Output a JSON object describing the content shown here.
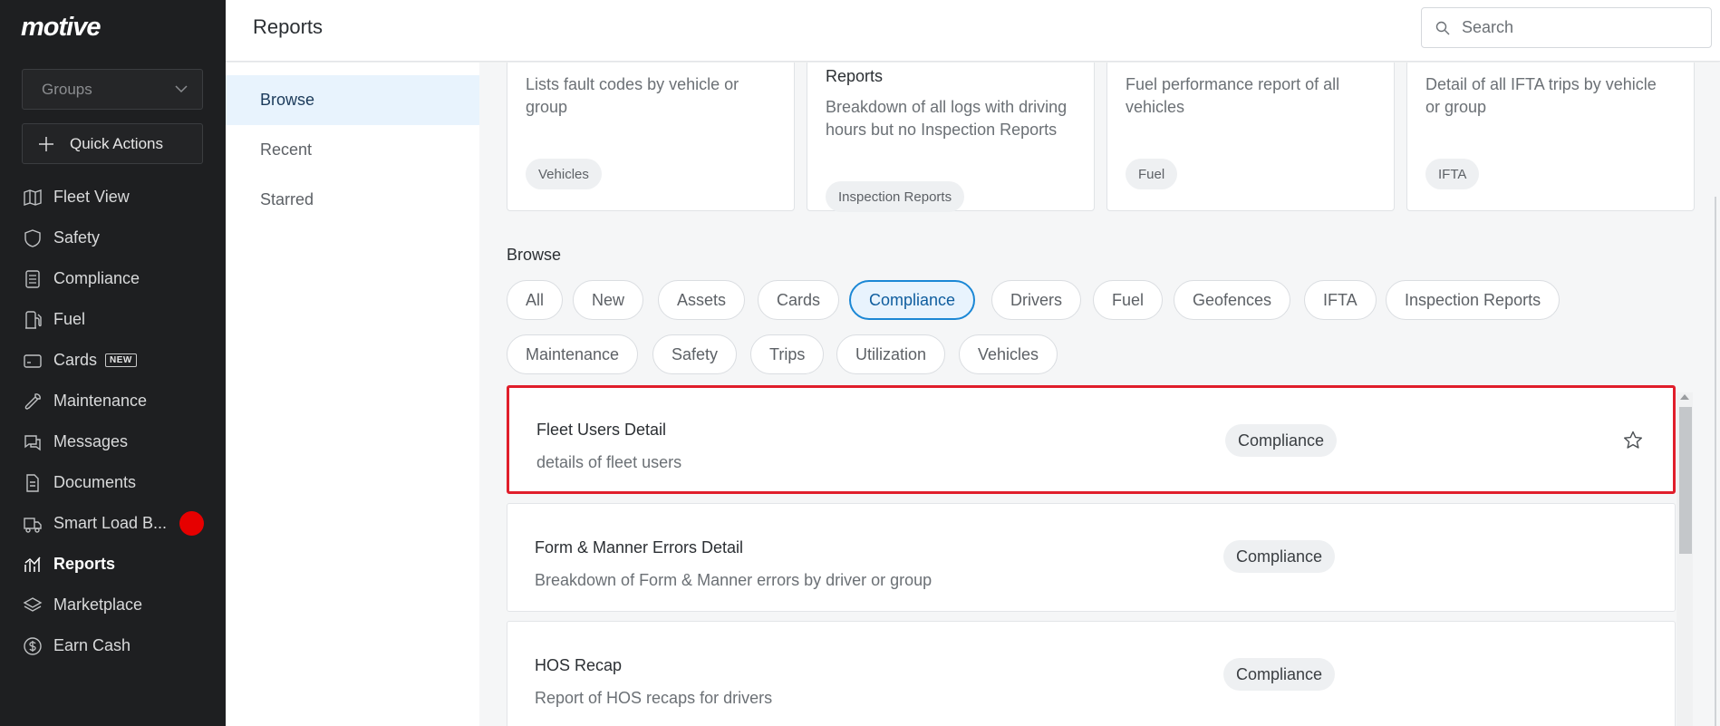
{
  "sidebar": {
    "logo": "motive",
    "groups_placeholder": "Groups",
    "quick_actions": "Quick Actions",
    "items": [
      {
        "label": "Fleet View",
        "icon": "map-icon"
      },
      {
        "label": "Safety",
        "icon": "shield-icon"
      },
      {
        "label": "Compliance",
        "icon": "document-list-icon"
      },
      {
        "label": "Fuel",
        "icon": "fuel-pump-icon"
      },
      {
        "label": "Cards",
        "icon": "card-icon",
        "badge": "NEW"
      },
      {
        "label": "Maintenance",
        "icon": "wrench-icon"
      },
      {
        "label": "Messages",
        "icon": "chat-icon"
      },
      {
        "label": "Documents",
        "icon": "file-icon"
      },
      {
        "label": "Smart Load B...",
        "icon": "truck-icon",
        "notification": true
      },
      {
        "label": "Reports",
        "icon": "chart-icon",
        "active": true
      },
      {
        "label": "Marketplace",
        "icon": "layers-icon"
      },
      {
        "label": "Earn Cash",
        "icon": "dollar-icon"
      }
    ]
  },
  "header": {
    "title": "Reports",
    "search_placeholder": "Search"
  },
  "subnav": {
    "items": [
      {
        "label": "Browse",
        "active": true
      },
      {
        "label": "Recent"
      },
      {
        "label": "Starred"
      }
    ]
  },
  "cards": [
    {
      "title": "",
      "desc1": "Lists fault codes by vehicle or",
      "desc2": "group",
      "tag": "Vehicles"
    },
    {
      "title": "Reports",
      "desc1": "Breakdown of all logs with driving",
      "desc2": "hours but no Inspection Reports",
      "tag": "Inspection Reports"
    },
    {
      "title": "",
      "desc1": "Fuel performance report of all",
      "desc2": "vehicles",
      "tag": "Fuel"
    },
    {
      "title": "",
      "desc1": "Detail of all IFTA trips by vehicle",
      "desc2": "or group",
      "tag": "IFTA"
    }
  ],
  "browse": {
    "label": "Browse",
    "chips": [
      "All",
      "New",
      "Assets",
      "Cards",
      "Compliance",
      "Drivers",
      "Fuel",
      "Geofences",
      "IFTA",
      "Inspection Reports",
      "Maintenance",
      "Safety",
      "Trips",
      "Utilization",
      "Vehicles"
    ],
    "active_chip": "Compliance"
  },
  "reports": [
    {
      "title": "Fleet Users Detail",
      "desc": "details of fleet users",
      "tag": "Compliance"
    },
    {
      "title": "Form & Manner Errors Detail",
      "desc": "Breakdown of Form & Manner errors by driver or group",
      "tag": "Compliance"
    },
    {
      "title": "HOS Recap",
      "desc": "Report of HOS recaps for drivers",
      "tag": "Compliance"
    }
  ],
  "colors": {
    "sidebar_bg": "#1e1f21",
    "accent": "#1a87d5",
    "highlight_border": "#e01e2b",
    "notification": "#e60000"
  }
}
